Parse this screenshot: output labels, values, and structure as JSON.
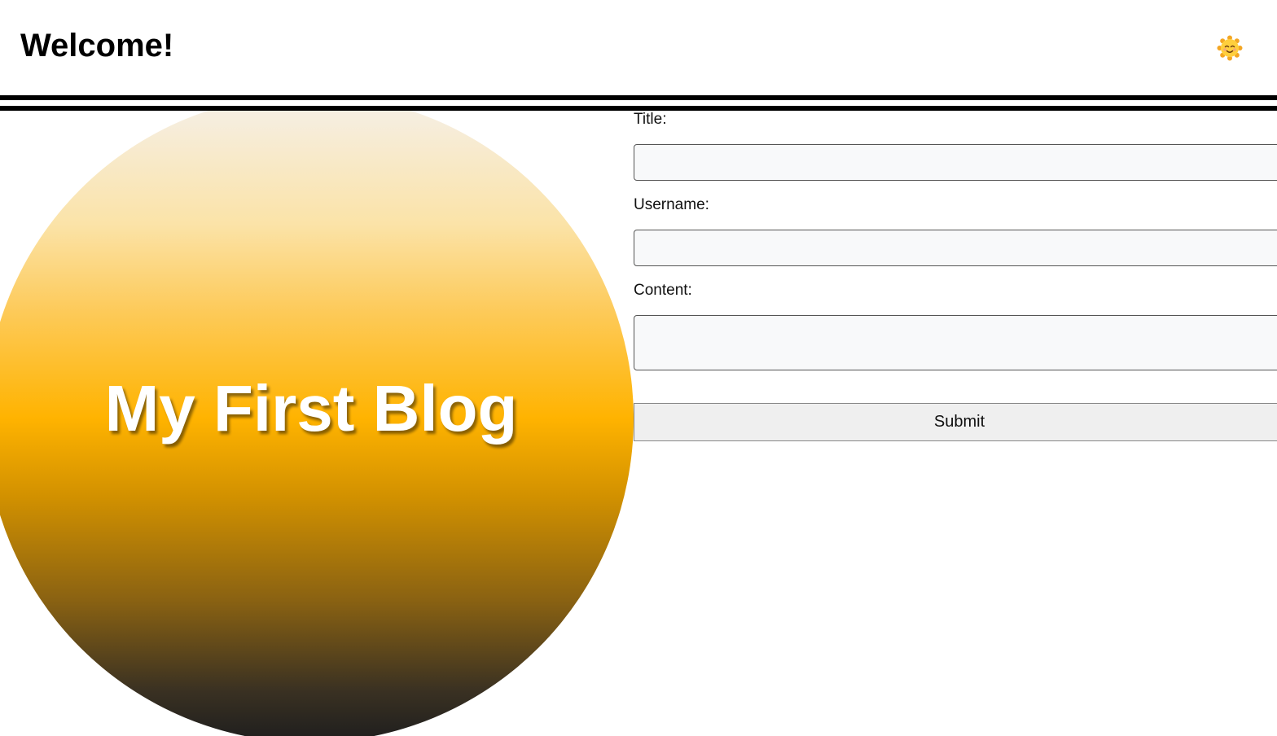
{
  "header": {
    "title": "Welcome!",
    "theme_icon": "sun-smile-icon"
  },
  "hero": {
    "title": "My First Blog"
  },
  "form": {
    "title_label": "Title:",
    "title_value": "",
    "username_label": "Username:",
    "username_value": "",
    "content_label": "Content:",
    "content_value": "",
    "submit_label": "Submit"
  },
  "colors": {
    "accent": "#ffb300",
    "rule": "#000000",
    "field_bg": "#f8f9fa",
    "button_bg": "#efefef"
  }
}
